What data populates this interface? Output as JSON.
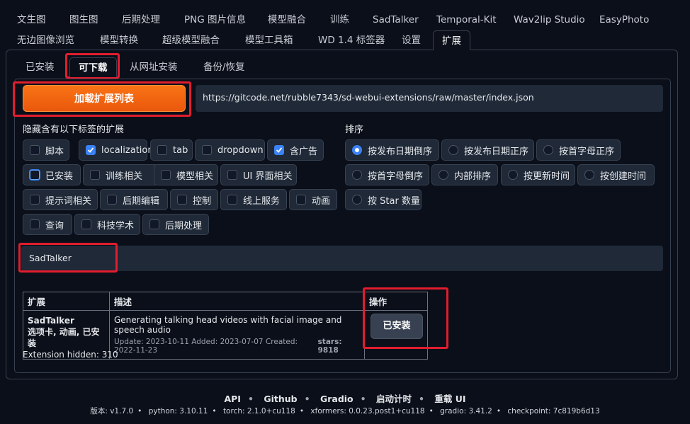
{
  "top_tabs_row1": [
    "文生图",
    "图生图",
    "后期处理",
    "PNG 图片信息",
    "模型融合",
    "训练",
    "SadTalker",
    "Temporal-Kit",
    "Wav2lip Studio",
    "EasyPhoto"
  ],
  "top_tabs_row2": [
    "无边图像浏览",
    "模型转换",
    "超级模型融合",
    "模型工具箱",
    "WD 1.4 标签器",
    "设置",
    "扩展"
  ],
  "active_top_tab": "扩展",
  "sub_tabs": [
    "已安装",
    "可下载",
    "从网址安装",
    "备份/恢复"
  ],
  "active_sub_tab": "可下载",
  "load_button_label": "加载扩展列表",
  "index_url": "https://gitcode.net/rubble7343/sd-webui-extensions/raw/master/index.json",
  "hide_tags_label": "隐藏含有以下标签的扩展",
  "hide_tags": [
    {
      "label": "脚本",
      "checked": false
    },
    {
      "label": "localization",
      "checked": true
    },
    {
      "label": "tab",
      "checked": false
    },
    {
      "label": "dropdown",
      "checked": false
    },
    {
      "label": "含广告",
      "checked": true
    },
    {
      "label": "已安装",
      "checked": false
    },
    {
      "label": "训练相关",
      "checked": false
    },
    {
      "label": "模型相关",
      "checked": false
    },
    {
      "label": "UI 界面相关",
      "checked": false
    },
    {
      "label": "提示词相关",
      "checked": false
    },
    {
      "label": "后期编辑",
      "checked": false
    },
    {
      "label": "控制",
      "checked": false
    },
    {
      "label": "线上服务",
      "checked": false
    },
    {
      "label": "动画",
      "checked": false
    },
    {
      "label": "查询",
      "checked": false
    },
    {
      "label": "科技学术",
      "checked": false
    },
    {
      "label": "后期处理",
      "checked": false
    }
  ],
  "sort_label": "排序",
  "sort_options": [
    {
      "label": "按发布日期倒序",
      "checked": true
    },
    {
      "label": "按发布日期正序",
      "checked": false
    },
    {
      "label": "按首字母正序",
      "checked": false
    },
    {
      "label": "按首字母倒序",
      "checked": false
    },
    {
      "label": "内部排序",
      "checked": false
    },
    {
      "label": "按更新时间",
      "checked": false
    },
    {
      "label": "按创建时间",
      "checked": false
    },
    {
      "label": "按 Star 数量",
      "checked": false
    }
  ],
  "search_value": "SadTalker",
  "table": {
    "headers": [
      "扩展",
      "描述",
      "操作"
    ],
    "row": {
      "name": "SadTalker",
      "tags": "选项卡, 动画, 已安装",
      "description": "Generating talking head videos with facial image and speech audio",
      "dates": "Update: 2023-10-11 Added: 2023-07-07 Created: 2022-11-23",
      "stars": "stars: 9818",
      "action_label": "已安装"
    }
  },
  "hidden_count": "Extension hidden: 310",
  "footer_links": [
    "API",
    "Github",
    "Gradio",
    "启动计时",
    "重载 UI"
  ],
  "versions": [
    "版本: v1.7.0",
    "python: 3.10.11",
    "torch: 2.1.0+cu118",
    "xformers: 0.0.23.post1+cu118",
    "gradio: 3.41.2",
    "checkpoint: 7c819b6d13"
  ],
  "colors": {
    "accent": "#f97316",
    "highlight": "#e11d2e",
    "check": "#3b82f6"
  }
}
